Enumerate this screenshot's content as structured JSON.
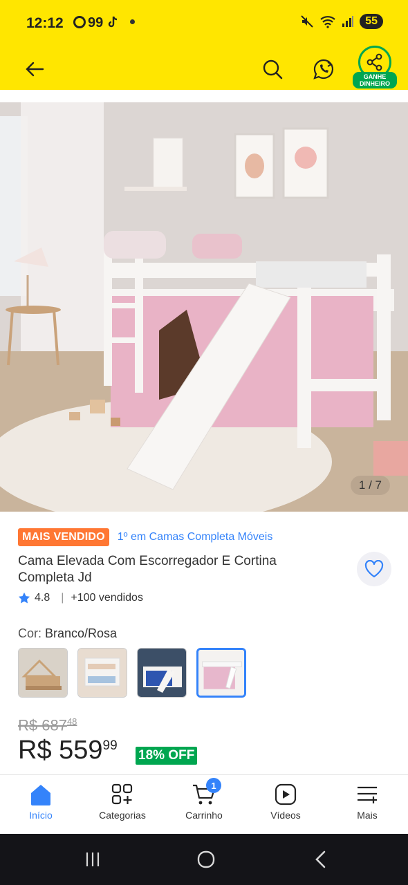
{
  "status_bar": {
    "time": "12:12",
    "app_indicator": "99",
    "battery": "55"
  },
  "top_nav": {
    "earn_label": "GANHE DINHEIRO"
  },
  "product": {
    "image_counter": "1 / 7",
    "badge": "MAIS VENDIDO",
    "badge_link": "1º em Camas Completa Móveis",
    "title": "Cama Elevada Com Escorregador E Cortina Completa Jd",
    "rating": "4.8",
    "separator": "|",
    "sold": "+100 vendidos",
    "color_prefix": "Cor: ",
    "color_value": "Branco/Rosa",
    "old_price": "R$ 687",
    "old_cents": "48",
    "new_price": "R$ 559",
    "new_cents": "99",
    "discount": "18% OFF"
  },
  "bottom_nav": {
    "items": [
      {
        "label": "Início",
        "icon": "home-icon"
      },
      {
        "label": "Categorias",
        "icon": "categories-icon"
      },
      {
        "label": "Carrinho",
        "icon": "cart-icon",
        "badge": "1"
      },
      {
        "label": "Vídeos",
        "icon": "video-icon"
      },
      {
        "label": "Mais",
        "icon": "menu-icon"
      }
    ]
  },
  "colors": {
    "brand_yellow": "#FFE600",
    "link_blue": "#3483FA",
    "badge_orange": "#FF7733",
    "discount_green": "#00A650"
  }
}
